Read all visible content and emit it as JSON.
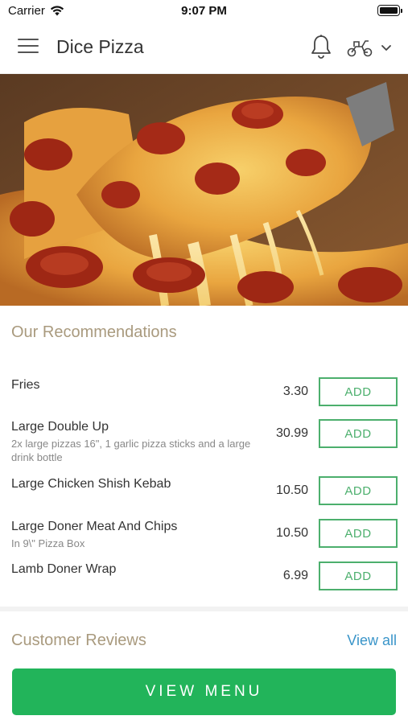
{
  "status_bar": {
    "carrier": "Carrier",
    "time": "9:07 PM"
  },
  "header": {
    "title": "Dice Pizza",
    "icons": [
      "hamburger-menu-icon",
      "bell-icon",
      "delivery-scooter-icon",
      "chevron-down-icon"
    ]
  },
  "hero": {
    "image": "pepperoni pizza slice being lifted with cheese pull"
  },
  "recommendations": {
    "title": "Our Recommendations",
    "add_label": "ADD",
    "items": [
      {
        "name": "Fries",
        "description": "",
        "price": "3.30"
      },
      {
        "name": "Large Double Up",
        "description": "2x large pizzas 16\", 1 garlic pizza sticks and a large drink bottle",
        "price": "30.99"
      },
      {
        "name": "Large Chicken Shish Kebab",
        "description": "",
        "price": "10.50"
      },
      {
        "name": "Large Doner Meat And Chips",
        "description": "In 9\\\" Pizza Box",
        "price": "10.50"
      },
      {
        "name": "Lamb Doner Wrap",
        "description": "",
        "price": "6.99"
      }
    ]
  },
  "reviews": {
    "title": "Customer Reviews",
    "view_all_label": "View all"
  },
  "footer": {
    "view_menu_label": "VIEW MENU"
  },
  "colors": {
    "accent_green": "#22b45a",
    "add_green": "#4caf6d",
    "section_title": "#a99a7e",
    "link_blue": "#3a95c9"
  }
}
